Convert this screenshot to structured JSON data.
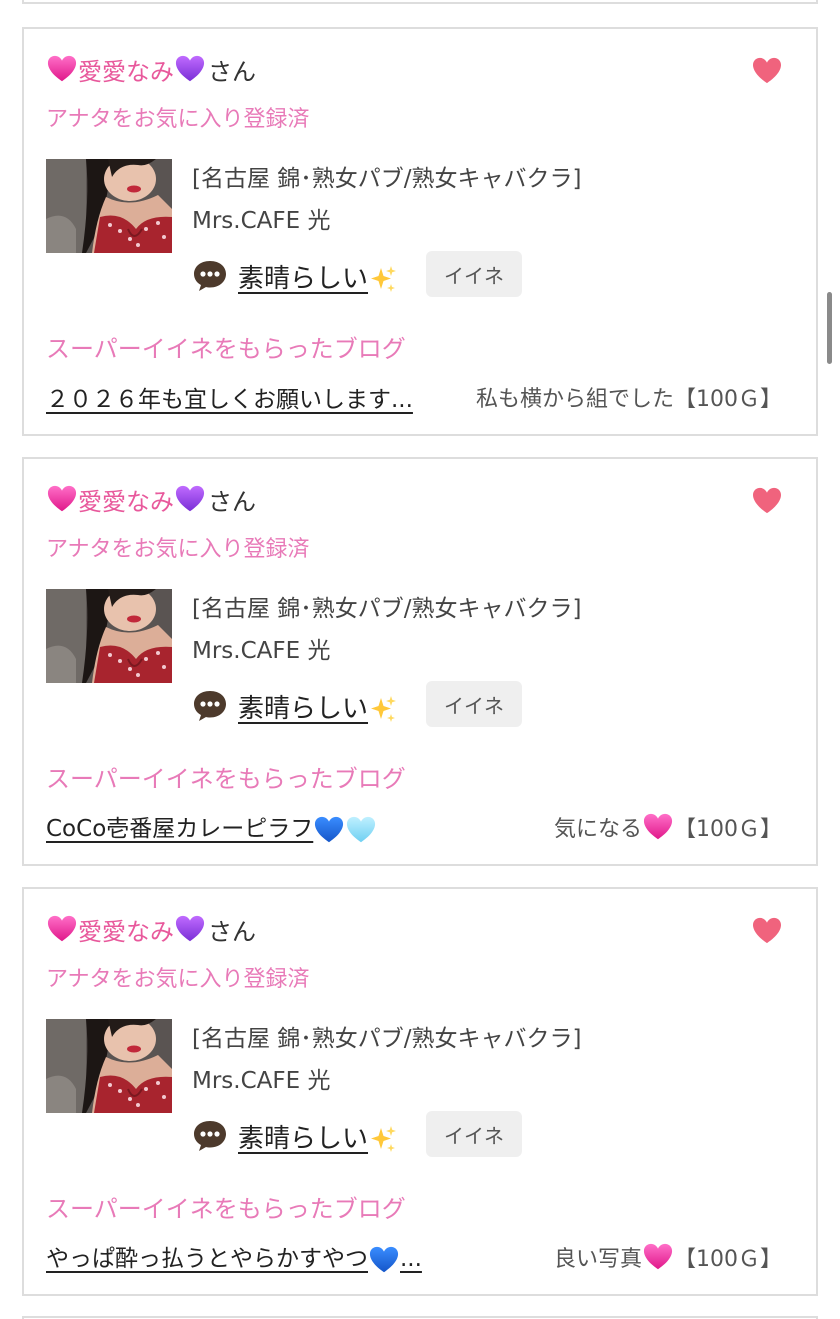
{
  "colors": {
    "accent_pink": "#e8599c",
    "label_pink": "#e87ab8",
    "favorite_heart": "#f0637d",
    "border": "#dddddd",
    "button_bg": "#efefef"
  },
  "cards": [
    {
      "name": {
        "prefix_emoji": "pink-heart",
        "text": "愛愛なみ",
        "suffix_emoji": "purple-heart",
        "honorific": "さん"
      },
      "favorite_icon": "heart-icon",
      "favorite_status": "アナタをお気に入り登録済",
      "shop": {
        "category": "[名古屋 錦･熟女パブ/熟女キャバクラ]",
        "name": "Mrs.CAFE 光"
      },
      "comment": {
        "icon": "speech-bubble-icon",
        "text": "素晴らしい",
        "emoji": "sparkles"
      },
      "iine_label": "イイネ",
      "blog_heading": "スーパーイイネをもらったブログ",
      "blog": {
        "title": "２０２６年も宜しくお願いします...",
        "comment_text": "私も横から組でした",
        "reward": "【100Ｇ】"
      }
    },
    {
      "name": {
        "prefix_emoji": "pink-heart",
        "text": "愛愛なみ",
        "suffix_emoji": "purple-heart",
        "honorific": "さん"
      },
      "favorite_icon": "heart-icon",
      "favorite_status": "アナタをお気に入り登録済",
      "shop": {
        "category": "[名古屋 錦･熟女パブ/熟女キャバクラ]",
        "name": "Mrs.CAFE 光"
      },
      "comment": {
        "icon": "speech-bubble-icon",
        "text": "素晴らしい",
        "emoji": "sparkles"
      },
      "iine_label": "イイネ",
      "blog_heading": "スーパーイイネをもらったブログ",
      "blog": {
        "title": "CoCo壱番屋カレーピラフ",
        "title_emojis": [
          "blue-heart",
          "light-blue-heart"
        ],
        "comment_text": "気になる",
        "comment_emoji": "pink-heart",
        "reward": "【100Ｇ】"
      }
    },
    {
      "name": {
        "prefix_emoji": "pink-heart",
        "text": "愛愛なみ",
        "suffix_emoji": "purple-heart",
        "honorific": "さん"
      },
      "favorite_icon": "heart-icon",
      "favorite_status": "アナタをお気に入り登録済",
      "shop": {
        "category": "[名古屋 錦･熟女パブ/熟女キャバクラ]",
        "name": "Mrs.CAFE 光"
      },
      "comment": {
        "icon": "speech-bubble-icon",
        "text": "素晴らしい",
        "emoji": "sparkles"
      },
      "iine_label": "イイネ",
      "blog_heading": "スーパーイイネをもらったブログ",
      "blog": {
        "title": "やっぱ酔っ払うとやらかすやつ",
        "title_emoji": "blue-heart",
        "title_ellipsis": "...",
        "comment_text": "良い写真",
        "comment_emoji": "pink-heart",
        "reward": "【100Ｇ】"
      }
    }
  ]
}
